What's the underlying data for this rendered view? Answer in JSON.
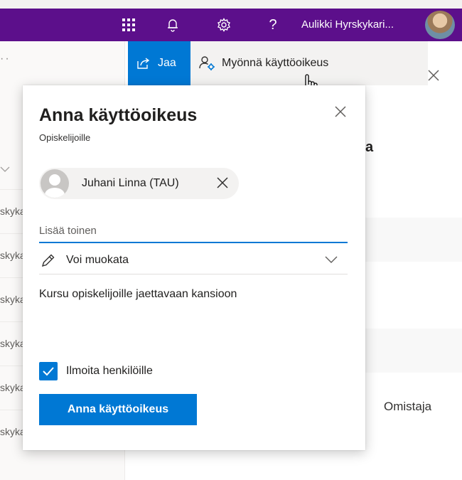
{
  "topbar": {
    "user_name": "Aulikki Hyrskykari...",
    "icons": [
      "waffle-icon",
      "bell-icon",
      "gear-icon",
      "help-icon"
    ],
    "help_glyph": "?",
    "color": "#5c0f8b"
  },
  "left_panel": {
    "overflow": "··",
    "rows": [
      "skyka",
      "skyka",
      "skyka",
      "skyka",
      "skyka",
      "skyka"
    ]
  },
  "command_bar": {
    "share_label": "Jaa",
    "grant_label": "Myönnä käyttöoikeus"
  },
  "background": {
    "heading_fragment": "a",
    "owner_label": "Omistaja"
  },
  "dialog": {
    "title": "Anna käyttöoikeus",
    "subtitle": "Opiskelijoille",
    "recipient": "Juhani Linna (TAU)",
    "add_placeholder": "Lisää toinen",
    "permission": "Voi muokata",
    "message": "Kursu opiskelijoille jaettavaan kansioon",
    "notify_label": "Ilmoita henkilöille",
    "notify_checked": true,
    "grant_button": "Anna käyttöoikeus",
    "accent": "#0078d4"
  }
}
